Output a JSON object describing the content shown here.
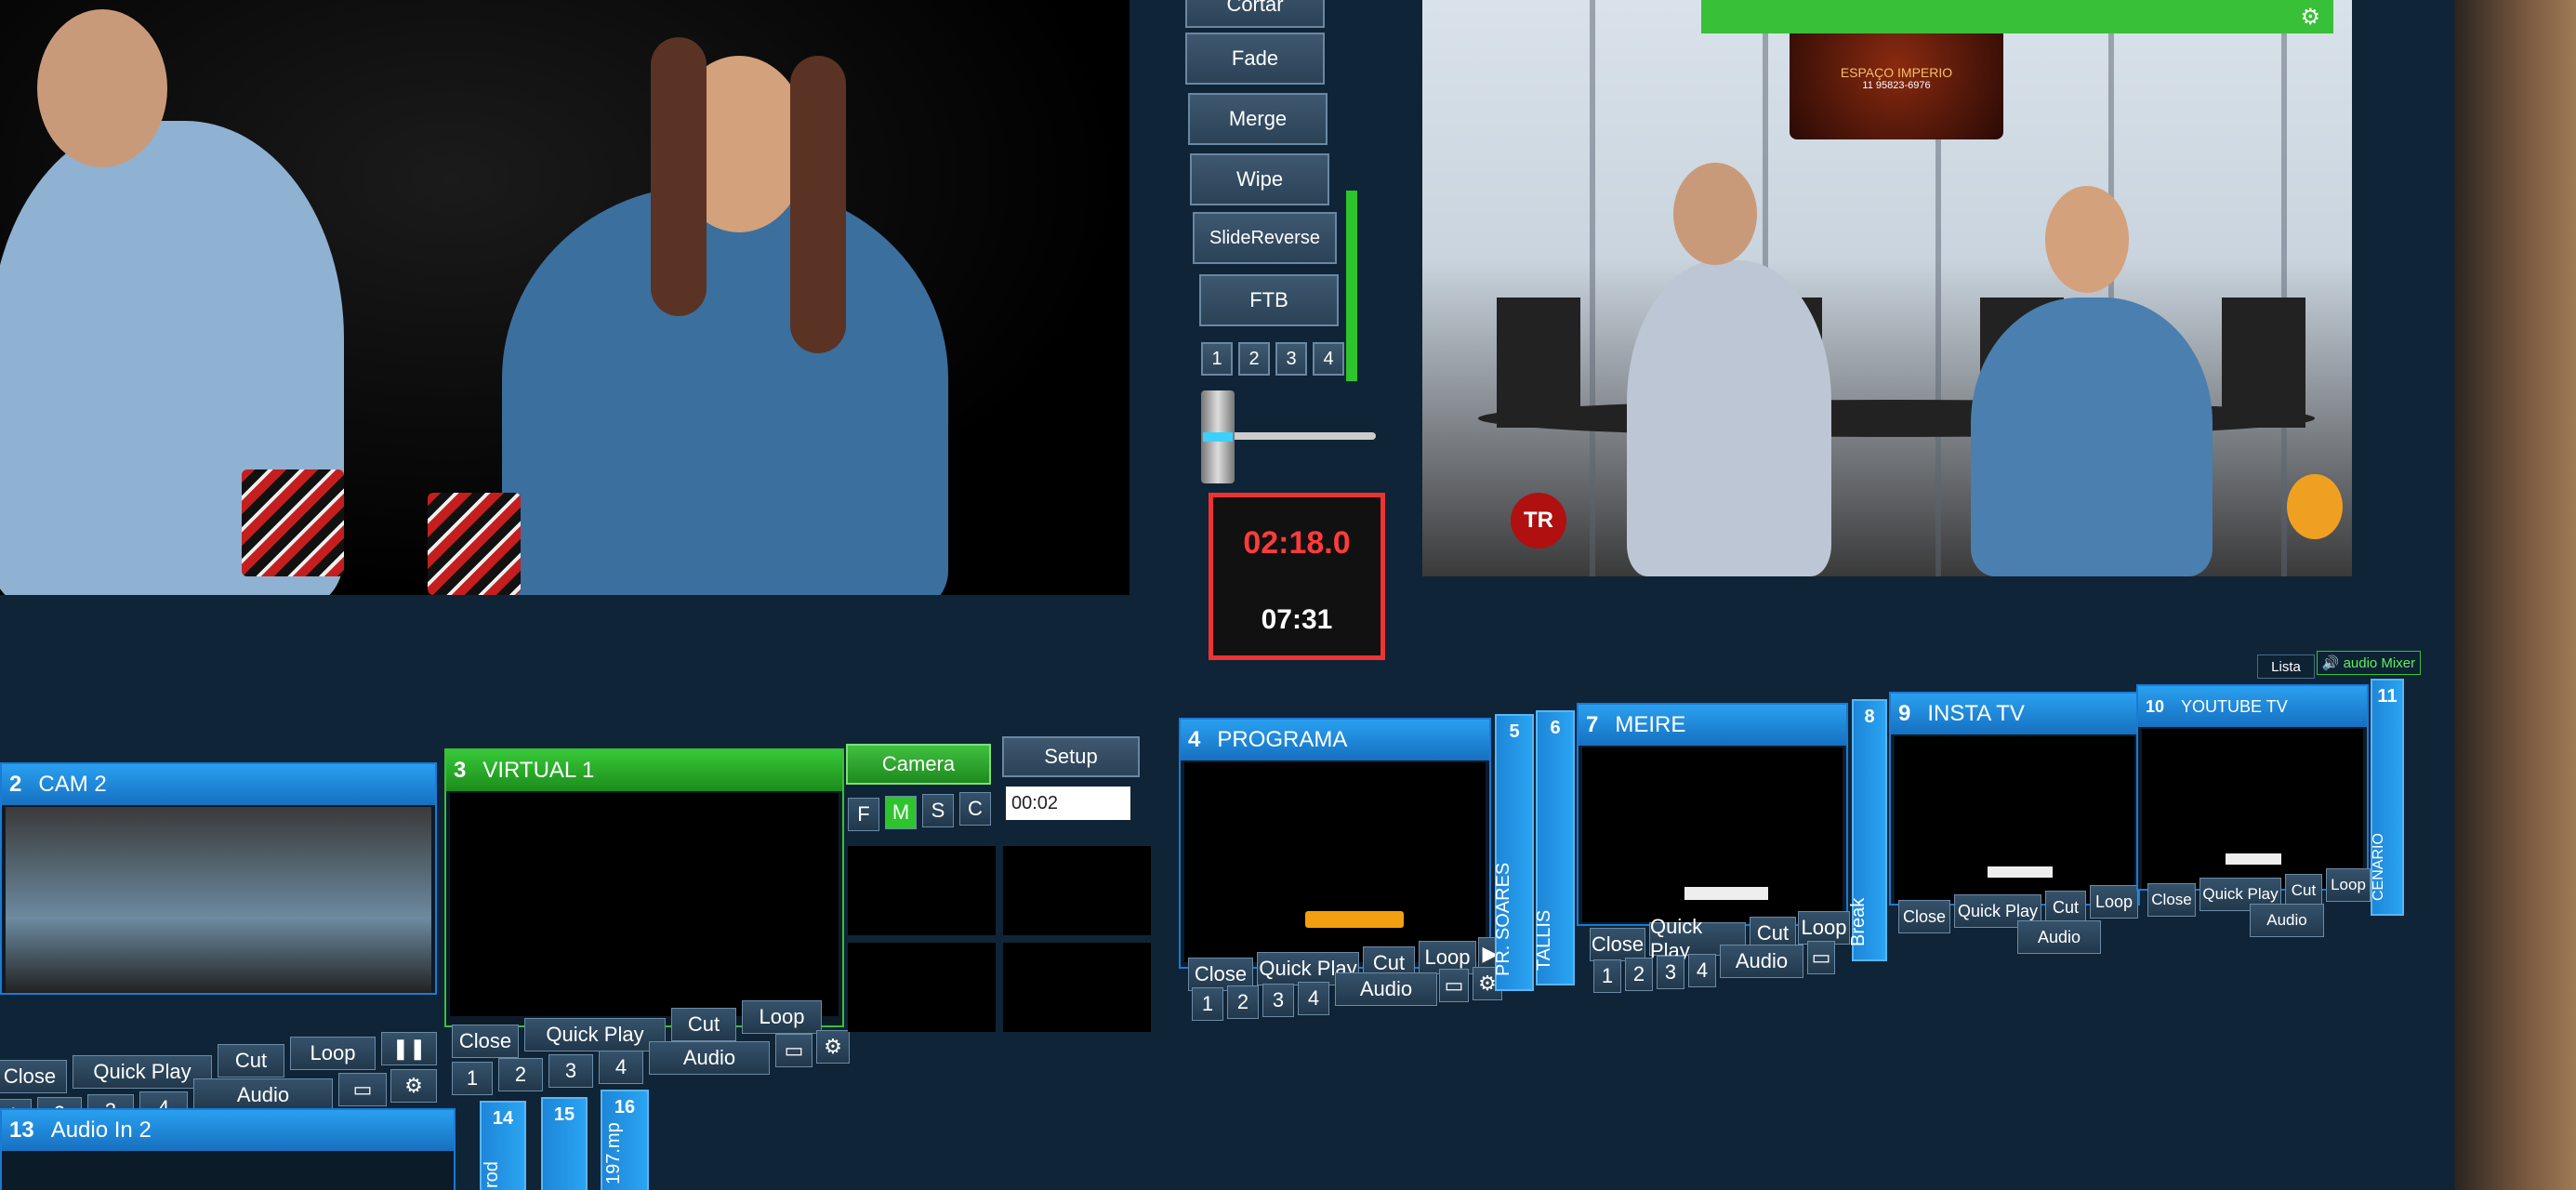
{
  "transitions": {
    "top_cut": "Cortar",
    "fade": "Fade",
    "merge": "Merge",
    "wipe": "Wipe",
    "slide": "SlideReverse",
    "ftb": "FTB",
    "nums": [
      "1",
      "2",
      "3",
      "4"
    ]
  },
  "timer": {
    "countdown": "02:18.0",
    "clock": "07:31"
  },
  "right_toggles": {
    "lista": "Lista",
    "audio": "audio Mixer"
  },
  "virtual_panel": {
    "camera_tab": "Camera",
    "setup_tab": "Setup",
    "modes": [
      "F",
      "M",
      "S",
      "C"
    ],
    "duration_value": "00:02"
  },
  "inputs": {
    "cam2": {
      "num": "2",
      "title": "CAM 2"
    },
    "virtual1": {
      "num": "3",
      "title": "VIRTUAL 1"
    },
    "programa": {
      "num": "4",
      "title": "PROGRAMA"
    },
    "meire": {
      "num": "7",
      "title": "MEIRE"
    },
    "insta": {
      "num": "9",
      "title": "INSTA TV"
    },
    "youtube": {
      "num": "10",
      "title": "YOUTUBE TV"
    },
    "audio13": {
      "num": "13",
      "title": "Audio In 2"
    }
  },
  "controls": {
    "close": "Close",
    "quick_play": "Quick Play",
    "cut": "Cut",
    "loop": "Loop",
    "audio": "Audio",
    "nums": [
      "1",
      "2",
      "3",
      "4"
    ]
  },
  "strips": {
    "s5": {
      "num": "5",
      "label": "PR. SOARES"
    },
    "s6": {
      "num": "6",
      "label": "TALLIS"
    },
    "s8": {
      "num": "8",
      "label": "Break"
    },
    "s11": {
      "num": "11",
      "label": "CENARIO"
    },
    "s14": {
      "num": "14",
      "label": "rod"
    },
    "s15": {
      "num": "15",
      "label": ""
    },
    "s16": {
      "num": "16",
      "label": "197.mp"
    }
  },
  "overlay_text": {
    "sign": "ESPAÇO IMPERIO",
    "sign_phone": "11 95823-6976",
    "logo": "TR"
  }
}
